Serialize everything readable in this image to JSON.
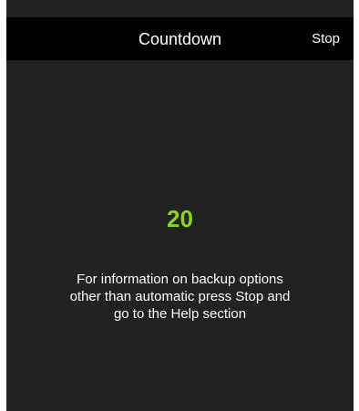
{
  "colors": {
    "accent": "#8fd21b",
    "nav_background": "#000000",
    "screen_background": "#222222",
    "text": "#ffffff"
  },
  "nav": {
    "title": "Countdown",
    "stop_label": "Stop"
  },
  "countdown": {
    "value": "20",
    "message": "For information on backup options other than automatic press Stop and go to the Help section"
  }
}
